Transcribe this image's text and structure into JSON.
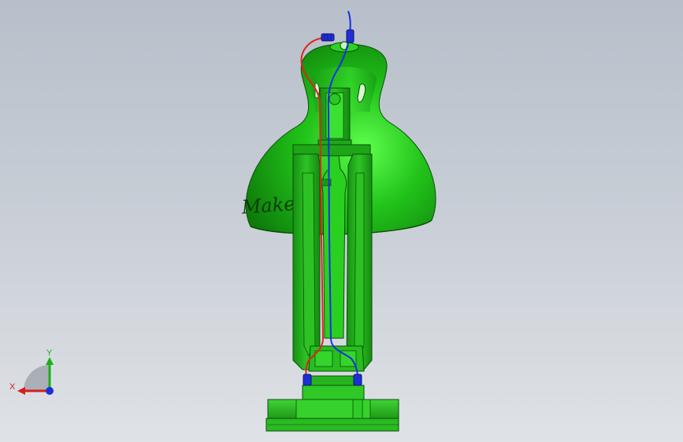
{
  "viewport": {
    "background_top": "#b7bfca",
    "background_bottom": "#dfe2e6"
  },
  "model": {
    "shade_color": "#22c41a",
    "shade_dark": "#0f6a0c",
    "frame_color": "#1e9e18",
    "base_color": "#2ab821",
    "wire_red": "#e0241c",
    "wire_blue": "#1a2ee6",
    "connector_color": "#1f2fd6",
    "engraving_text": "Maker"
  },
  "triad": {
    "x_label": "X",
    "y_label": "Y",
    "x_color": "#d81c1c",
    "y_color": "#18b018",
    "z_color": "#1c2ed8"
  }
}
